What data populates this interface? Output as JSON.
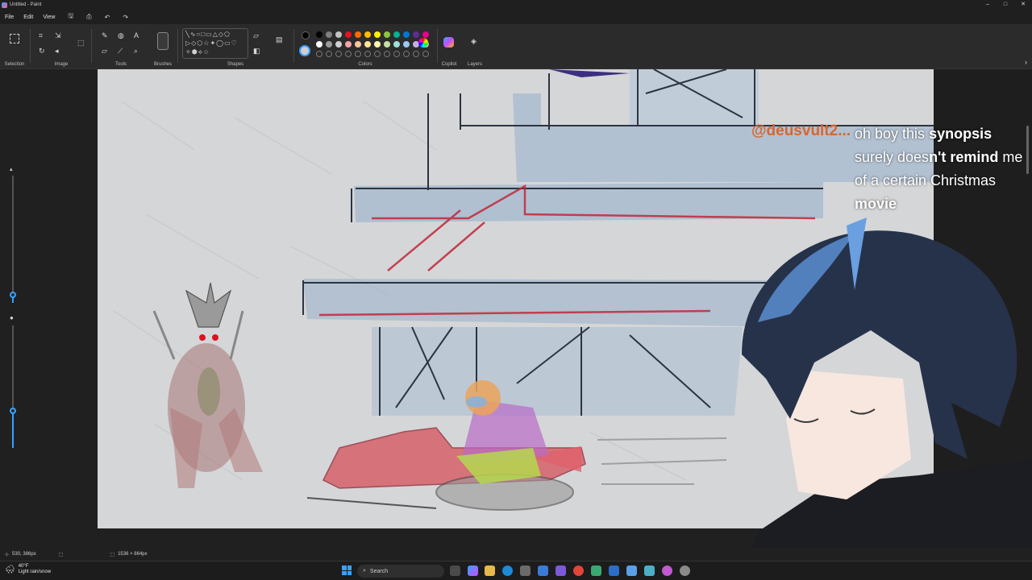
{
  "window": {
    "title": "Untitled - Paint",
    "controls": [
      "–",
      "□",
      "✕"
    ]
  },
  "menu": {
    "file": "File",
    "edit": "Edit",
    "view": "View"
  },
  "ribbon": {
    "groups": {
      "selection": "Selection",
      "image": "Image",
      "tools": "Tools",
      "brushes": "Brushes",
      "shapes": "Shapes",
      "colors": "Colors",
      "copilot": "Copilot",
      "layers": "Layers"
    },
    "palette_row1": [
      "#000000",
      "#7f7f7f",
      "#c3c3c3",
      "#e81123",
      "#ff6a00",
      "#ffb900",
      "#fff100",
      "#8cc63f",
      "#00b294",
      "#0078d4",
      "#5c2d91",
      "#e3008c"
    ],
    "palette_row2": [
      "#ffffff",
      "#9a9a9a",
      "#d0d0d0",
      "#f4a3a8",
      "#f7c59f",
      "#ffe599",
      "#fff9b0",
      "#c6e0a5",
      "#a0e0d6",
      "#99c9f0",
      "#c4b0e0",
      "#f0a8d8"
    ]
  },
  "statusbar": {
    "cursor": "530, 386px",
    "size": "1536 × 864px"
  },
  "weather": {
    "temp": "40°F",
    "condition": "Light rain/snow"
  },
  "taskbar": {
    "search_placeholder": "Search"
  },
  "overlay": {
    "handle": "@deusvult2...",
    "message_parts": [
      {
        "text": "oh boy this ",
        "bold": false
      },
      {
        "text": "synopsis",
        "bold": true
      },
      {
        "text": " surely does",
        "bold": false
      },
      {
        "text": "n't remind",
        "bold": true
      },
      {
        "text": " me of a certain Christmas ",
        "bold": false
      },
      {
        "text": "movie",
        "bold": true
      }
    ]
  },
  "colors": {
    "canvas": "#d5d6d8",
    "accent": "#3aa0ff",
    "handle": "#d9662e"
  }
}
